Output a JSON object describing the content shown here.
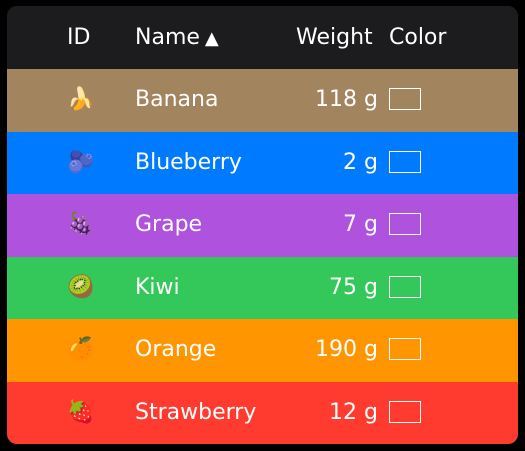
{
  "header": {
    "id_label": "ID",
    "name_label": "Name",
    "sort_indicator": "▲",
    "weight_label": "Weight",
    "color_label": "Color"
  },
  "rows": [
    {
      "id": "🍌",
      "icon": "banana-icon",
      "name": "Banana",
      "weight": "118 g",
      "color": "#a2845e"
    },
    {
      "id": "🫐",
      "icon": "blueberry-icon",
      "name": "Blueberry",
      "weight": "2 g",
      "color": "#007aff"
    },
    {
      "id": "🍇",
      "icon": "grape-icon",
      "name": "Grape",
      "weight": "7 g",
      "color": "#af52de"
    },
    {
      "id": "🥝",
      "icon": "kiwi-icon",
      "name": "Kiwi",
      "weight": "75 g",
      "color": "#34c759"
    },
    {
      "id": "🍊",
      "icon": "orange-icon",
      "name": "Orange",
      "weight": "190 g",
      "color": "#ff9500"
    },
    {
      "id": "🍓",
      "icon": "strawberry-icon",
      "name": "Strawberry",
      "weight": "12 g",
      "color": "#ff3b30"
    }
  ]
}
